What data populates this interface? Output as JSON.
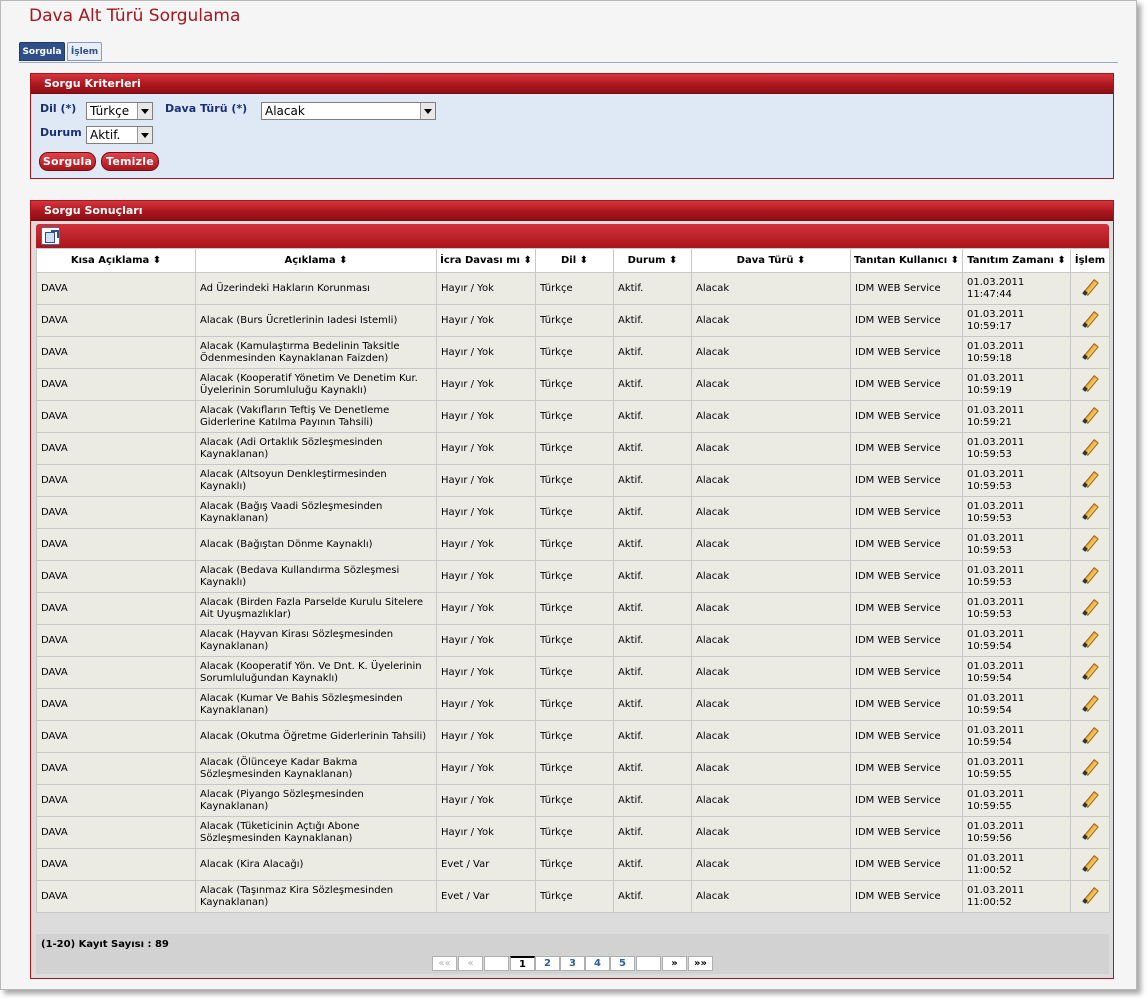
{
  "page": {
    "title": "Dava Alt Türü Sorgulama"
  },
  "tabs": [
    {
      "label": "Sorgula",
      "active": true
    },
    {
      "label": "İşlem",
      "active": false
    }
  ],
  "criteria": {
    "title": "Sorgu Kriterleri",
    "dil_label": "Dil (*)",
    "dil_value": "Türkçe",
    "dava_turu_label": "Dava Türü (*)",
    "dava_turu_value": "Alacak",
    "durum_label": "Durum",
    "durum_value": "Aktif.",
    "search_button": "Sorgula",
    "clear_button": "Temizle"
  },
  "results": {
    "title": "Sorgu Sonuçları",
    "columns": [
      "Kısa Açıklama ⬍",
      "Açıklama ⬍",
      "İcra Davası mı ⬍",
      "Dil ⬍",
      "Durum ⬍",
      "Dava Türü ⬍",
      "Tanıtan Kullanıcı ⬍",
      "Tanıtım Zamanı ⬍",
      "İşlem"
    ],
    "rows": [
      [
        "DAVA",
        "Ad Üzerindeki Hakların Korunması",
        "Hayır / Yok",
        "Türkçe",
        "Aktif.",
        "Alacak",
        "IDM WEB Service",
        "01.03.2011 11:47:44"
      ],
      [
        "DAVA",
        "Alacak (Burs Ücretlerinin Iadesi Istemli)",
        "Hayır / Yok",
        "Türkçe",
        "Aktif.",
        "Alacak",
        "IDM WEB Service",
        "01.03.2011 10:59:17"
      ],
      [
        "DAVA",
        "Alacak (Kamulaştırma Bedelinin Taksitle Ödenmesinden Kaynaklanan Faizden)",
        "Hayır / Yok",
        "Türkçe",
        "Aktif.",
        "Alacak",
        "IDM WEB Service",
        "01.03.2011 10:59:18"
      ],
      [
        "DAVA",
        "Alacak (Kooperatif Yönetim Ve Denetim Kur. Üyelerinin Sorumluluğu Kaynaklı)",
        "Hayır / Yok",
        "Türkçe",
        "Aktif.",
        "Alacak",
        "IDM WEB Service",
        "01.03.2011 10:59:19"
      ],
      [
        "DAVA",
        "Alacak (Vakıfların Teftiş Ve Denetleme Giderlerine Katılma Payının Tahsili)",
        "Hayır / Yok",
        "Türkçe",
        "Aktif.",
        "Alacak",
        "IDM WEB Service",
        "01.03.2011 10:59:21"
      ],
      [
        "DAVA",
        "Alacak (Adi Ortaklık Sözleşmesinden Kaynaklanan)",
        "Hayır / Yok",
        "Türkçe",
        "Aktif.",
        "Alacak",
        "IDM WEB Service",
        "01.03.2011 10:59:53"
      ],
      [
        "DAVA",
        "Alacak (Altsoyun Denkleştirmesinden Kaynaklı)",
        "Hayır / Yok",
        "Türkçe",
        "Aktif.",
        "Alacak",
        "IDM WEB Service",
        "01.03.2011 10:59:53"
      ],
      [
        "DAVA",
        "Alacak (Bağış Vaadi Sözleşmesinden Kaynaklanan)",
        "Hayır / Yok",
        "Türkçe",
        "Aktif.",
        "Alacak",
        "IDM WEB Service",
        "01.03.2011 10:59:53"
      ],
      [
        "DAVA",
        "Alacak (Bağıştan Dönme Kaynaklı)",
        "Hayır / Yok",
        "Türkçe",
        "Aktif.",
        "Alacak",
        "IDM WEB Service",
        "01.03.2011 10:59:53"
      ],
      [
        "DAVA",
        "Alacak (Bedava Kullandırma Sözleşmesi Kaynaklı)",
        "Hayır / Yok",
        "Türkçe",
        "Aktif.",
        "Alacak",
        "IDM WEB Service",
        "01.03.2011 10:59:53"
      ],
      [
        "DAVA",
        "Alacak (Birden Fazla Parselde Kurulu Sitelere Ait Uyuşmazlıklar)",
        "Hayır / Yok",
        "Türkçe",
        "Aktif.",
        "Alacak",
        "IDM WEB Service",
        "01.03.2011 10:59:53"
      ],
      [
        "DAVA",
        "Alacak (Hayvan Kirası Sözleşmesinden Kaynaklanan)",
        "Hayır / Yok",
        "Türkçe",
        "Aktif.",
        "Alacak",
        "IDM WEB Service",
        "01.03.2011 10:59:54"
      ],
      [
        "DAVA",
        "Alacak (Kooperatif Yön. Ve Dnt. K. Üyelerinin Sorumluluğundan Kaynaklı)",
        "Hayır / Yok",
        "Türkçe",
        "Aktif.",
        "Alacak",
        "IDM WEB Service",
        "01.03.2011 10:59:54"
      ],
      [
        "DAVA",
        "Alacak (Kumar Ve Bahis Sözleşmesinden Kaynaklanan)",
        "Hayır / Yok",
        "Türkçe",
        "Aktif.",
        "Alacak",
        "IDM WEB Service",
        "01.03.2011 10:59:54"
      ],
      [
        "DAVA",
        "Alacak (Okutma Öğretme Giderlerinin Tahsili)",
        "Hayır / Yok",
        "Türkçe",
        "Aktif.",
        "Alacak",
        "IDM WEB Service",
        "01.03.2011 10:59:54"
      ],
      [
        "DAVA",
        "Alacak (Ölünceye Kadar Bakma Sözleşmesinden Kaynaklanan)",
        "Hayır / Yok",
        "Türkçe",
        "Aktif.",
        "Alacak",
        "IDM WEB Service",
        "01.03.2011 10:59:55"
      ],
      [
        "DAVA",
        "Alacak (Piyango Sözleşmesinden Kaynaklanan)",
        "Hayır / Yok",
        "Türkçe",
        "Aktif.",
        "Alacak",
        "IDM WEB Service",
        "01.03.2011 10:59:55"
      ],
      [
        "DAVA",
        "Alacak (Tüketicinin Açtığı Abone Sözleşmesinden Kaynaklanan)",
        "Hayır / Yok",
        "Türkçe",
        "Aktif.",
        "Alacak",
        "IDM WEB Service",
        "01.03.2011 10:59:56"
      ],
      [
        "DAVA",
        "Alacak (Kira Alacağı)",
        "Evet / Var",
        "Türkçe",
        "Aktif.",
        "Alacak",
        "IDM WEB Service",
        "01.03.2011 11:00:52"
      ],
      [
        "DAVA",
        "Alacak (Taşınmaz Kira Sözleşmesinden Kaynaklanan)",
        "Evet / Var",
        "Türkçe",
        "Aktif.",
        "Alacak",
        "IDM WEB Service",
        "01.03.2011 11:00:52"
      ]
    ],
    "record_count": "(1-20) Kayıt Sayısı : 89",
    "pager": {
      "first": "««",
      "prev": "«",
      "pages": [
        "1",
        "2",
        "3",
        "4",
        "5"
      ],
      "current": "1",
      "next": "»",
      "last": "»»"
    }
  },
  "colors": {
    "accent_red": "#a8151c",
    "panel_blue": "#dfe8f5",
    "title_red": "#a8151c"
  }
}
